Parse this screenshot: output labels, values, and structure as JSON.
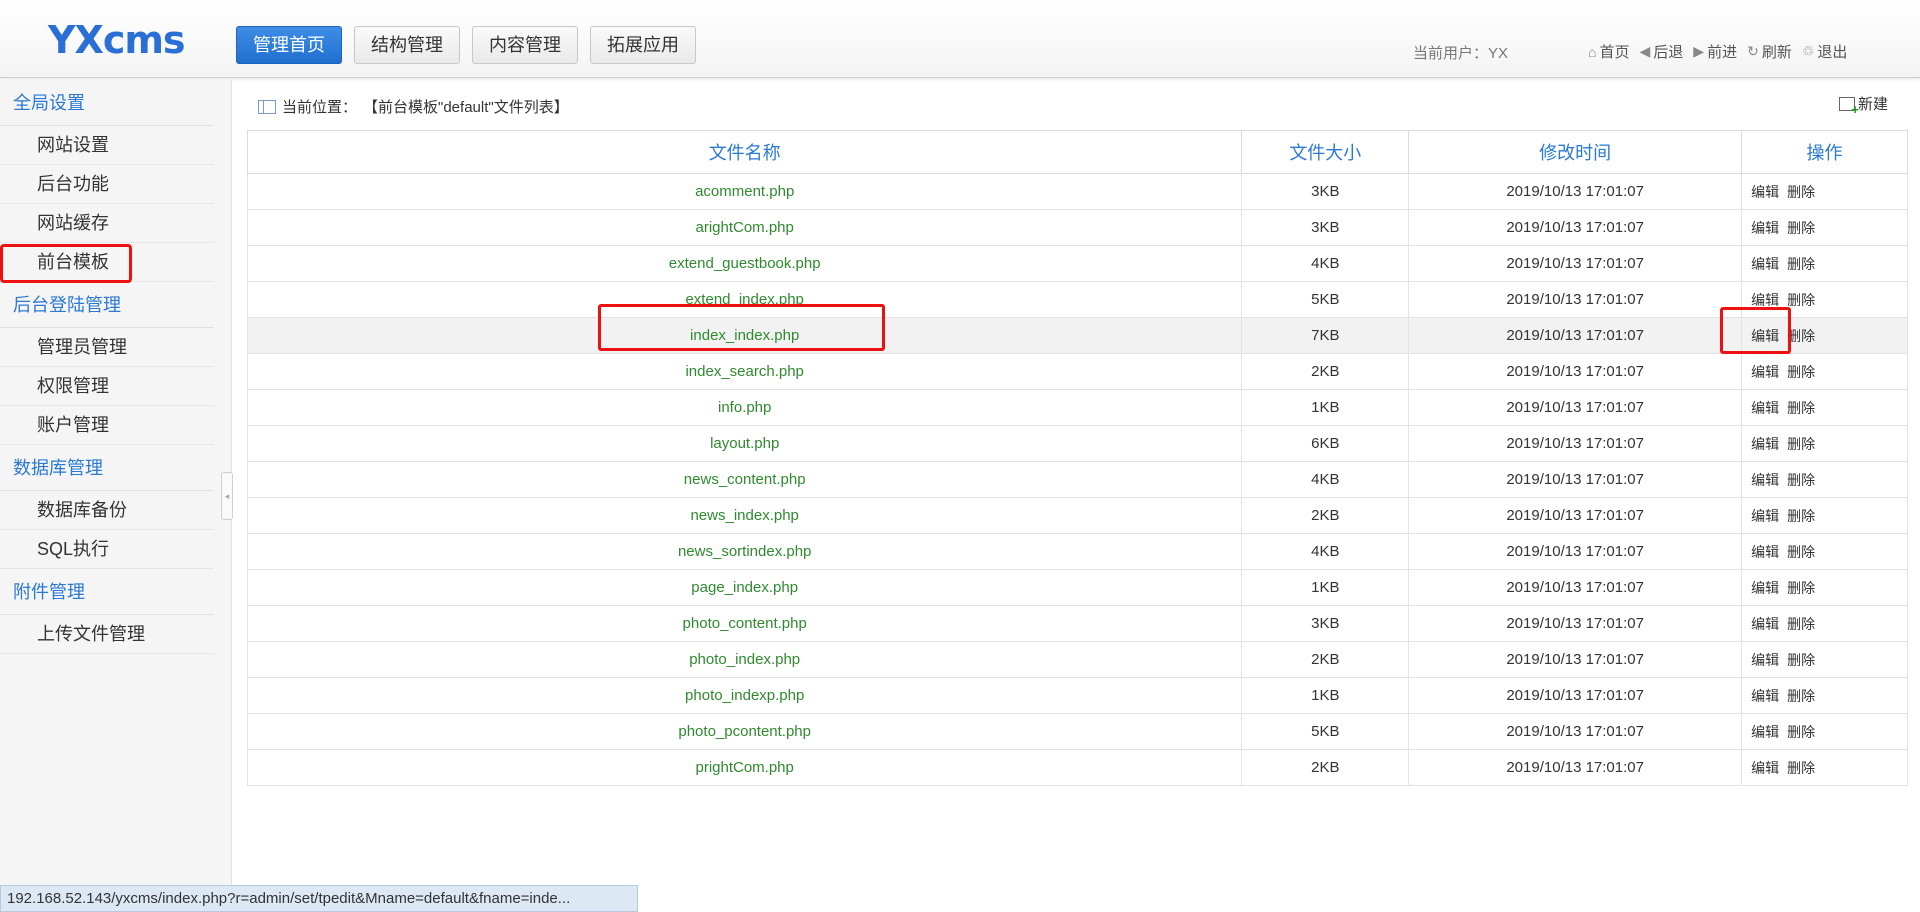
{
  "header": {
    "logo": "YXcms",
    "nav": [
      "管理首页",
      "结构管理",
      "内容管理",
      "拓展应用"
    ],
    "current_user_label": "当前用户：",
    "current_user_name": "YX",
    "links": [
      {
        "icon": "home-icon",
        "glyph": "⌂",
        "label": "首页"
      },
      {
        "icon": "back-icon",
        "glyph": "◀",
        "label": "后退"
      },
      {
        "icon": "forward-icon",
        "glyph": "▶",
        "label": "前进"
      },
      {
        "icon": "refresh-icon",
        "glyph": "↻",
        "label": "刷新"
      },
      {
        "icon": "logout-icon",
        "glyph": "♲",
        "label": "退出"
      }
    ]
  },
  "sidebar": {
    "groups": [
      {
        "title": "全局设置",
        "items": [
          "网站设置",
          "后台功能",
          "网站缓存",
          "前台模板"
        ]
      },
      {
        "title": "后台登陆管理",
        "items": [
          "管理员管理",
          "权限管理",
          "账户管理"
        ]
      },
      {
        "title": "数据库管理",
        "items": [
          "数据库备份",
          "SQL执行"
        ]
      },
      {
        "title": "附件管理",
        "items": [
          "上传文件管理"
        ]
      }
    ],
    "highlighted_item": "前台模板"
  },
  "main": {
    "breadcrumb_label": "当前位置：",
    "breadcrumb_value": "【前台模板\"default\"文件列表】",
    "new_label": "新建",
    "table": {
      "headers": [
        "文件名称",
        "文件大小",
        "修改时间",
        "操作"
      ],
      "edit_label": "编辑",
      "delete_label": "删除",
      "rows": [
        {
          "name": "acomment.php",
          "size": "3KB",
          "time": "2019/10/13 17:01:07"
        },
        {
          "name": "arightCom.php",
          "size": "3KB",
          "time": "2019/10/13 17:01:07"
        },
        {
          "name": "extend_guestbook.php",
          "size": "4KB",
          "time": "2019/10/13 17:01:07"
        },
        {
          "name": "extend_index.php",
          "size": "5KB",
          "time": "2019/10/13 17:01:07"
        },
        {
          "name": "index_index.php",
          "size": "7KB",
          "time": "2019/10/13 17:01:07"
        },
        {
          "name": "index_search.php",
          "size": "2KB",
          "time": "2019/10/13 17:01:07"
        },
        {
          "name": "info.php",
          "size": "1KB",
          "time": "2019/10/13 17:01:07"
        },
        {
          "name": "layout.php",
          "size": "6KB",
          "time": "2019/10/13 17:01:07"
        },
        {
          "name": "news_content.php",
          "size": "4KB",
          "time": "2019/10/13 17:01:07"
        },
        {
          "name": "news_index.php",
          "size": "2KB",
          "time": "2019/10/13 17:01:07"
        },
        {
          "name": "news_sortindex.php",
          "size": "4KB",
          "time": "2019/10/13 17:01:07"
        },
        {
          "name": "page_index.php",
          "size": "1KB",
          "time": "2019/10/13 17:01:07"
        },
        {
          "name": "photo_content.php",
          "size": "3KB",
          "time": "2019/10/13 17:01:07"
        },
        {
          "name": "photo_index.php",
          "size": "2KB",
          "time": "2019/10/13 17:01:07"
        },
        {
          "name": "photo_indexp.php",
          "size": "1KB",
          "time": "2019/10/13 17:01:07"
        },
        {
          "name": "photo_pcontent.php",
          "size": "5KB",
          "time": "2019/10/13 17:01:07"
        },
        {
          "name": "prightCom.php",
          "size": "2KB",
          "time": "2019/10/13 17:01:07"
        }
      ],
      "hovered_row": "index_index.php"
    }
  },
  "statusbar": {
    "url": "192.168.52.143/yxcms/index.php?r=admin/set/tpedit&Mname=default&fname=inde..."
  },
  "colors": {
    "accent_blue": "#2a79d4",
    "file_green": "#2f8a2f",
    "annotation_red": "#ee1111"
  }
}
